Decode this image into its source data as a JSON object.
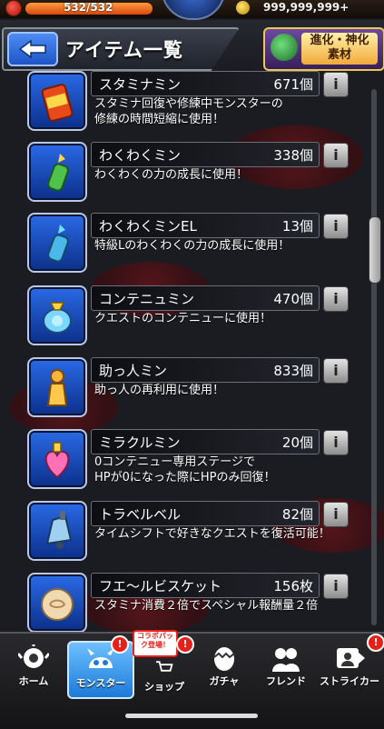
{
  "status_bar": {
    "stamina": "532/532",
    "coins": "999,999,999+"
  },
  "header": {
    "title": "アイテム一覧",
    "evolve_badge": [
      "進化・神化",
      "素材"
    ]
  },
  "items": [
    {
      "name": "スタミナミン",
      "count": "671個",
      "description": "スタミナ回復や修練中モンスターの\n修練の時間短縮に使用！",
      "icon": "can-icon"
    },
    {
      "name": "わくわくミン",
      "count": "338個",
      "description": "わくわくの力の成長に使用！",
      "icon": "green-bottle-icon"
    },
    {
      "name": "わくわくミンEL",
      "count": "13個",
      "description": "特級Lのわくわくの力の成長に使用！",
      "icon": "blue-bottle-icon"
    },
    {
      "name": "コンテニュミン",
      "count": "470個",
      "description": "クエストのコンテニューに使用！",
      "icon": "gem-jar-icon"
    },
    {
      "name": "助っ人ミン",
      "count": "833個",
      "description": "助っ人の再利用に使用！",
      "icon": "pawn-icon"
    },
    {
      "name": "ミラクルミン",
      "count": "20個",
      "description": "0コンテニュー専用ステージで\nHPが0になった際にHPのみ回復！",
      "icon": "heart-potion-icon"
    },
    {
      "name": "トラベルベル",
      "count": "82個",
      "description": "タイムシフトで好きなクエストを復活可能！",
      "icon": "bell-icon"
    },
    {
      "name": "フエ～ルビスケット",
      "count": "156枚",
      "description": "スタミナ消費２倍でスペシャル報酬量２倍",
      "icon": "biscuit-icon"
    }
  ],
  "info_label": "i",
  "nav": {
    "items": [
      {
        "label": "ホーム",
        "icon": "home-icon"
      },
      {
        "label": "モンスター",
        "icon": "monster-icon"
      },
      {
        "label": "ショップ",
        "icon": "shop-cart-icon"
      },
      {
        "label": "ガチャ",
        "icon": "gacha-egg-icon"
      },
      {
        "label": "フレンド",
        "icon": "friends-icon"
      },
      {
        "label": "ストライカー",
        "icon": "striker-icon"
      }
    ],
    "collab_badge": "コラボパック登場！",
    "notify_mark": "!"
  }
}
